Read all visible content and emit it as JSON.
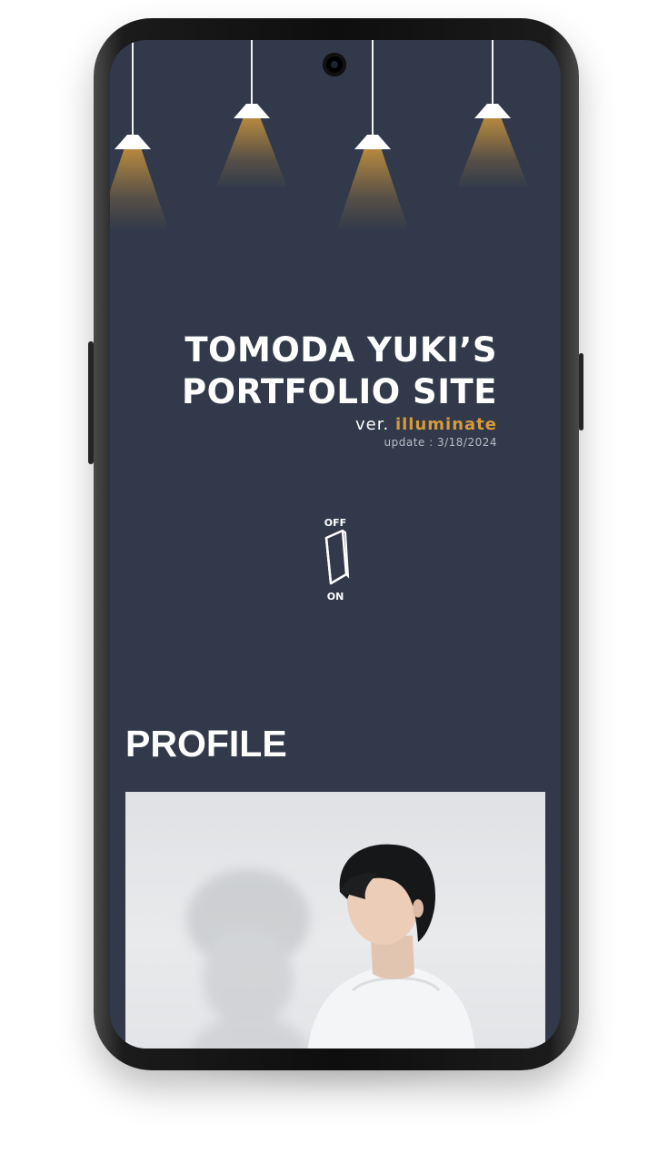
{
  "hero": {
    "title_line1": "TOMODA YUKI’S",
    "title_line2": "PORTFOLIO SITE",
    "version_prefix": "ver.",
    "version_name": "illuminate",
    "update": "update : 3/18/2024"
  },
  "light_switch": {
    "off_label": "OFF",
    "on_label": "ON"
  },
  "profile": {
    "heading": "PROFILE"
  },
  "colors": {
    "background": "#31394a",
    "accent": "#d79a3b",
    "text": "#ffffff"
  },
  "icons": [
    "pendant-lamp-icon",
    "light-switch-icon"
  ]
}
